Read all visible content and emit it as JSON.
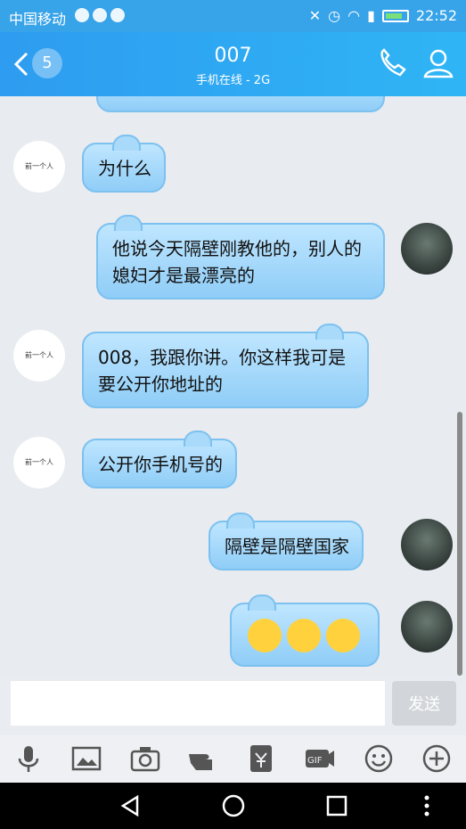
{
  "status_bar": {
    "carrier": "中国移动",
    "time": "22:52"
  },
  "header": {
    "back_badge": "5",
    "title": "007",
    "subtitle": "手机在线 - 2G"
  },
  "messages": [
    {
      "side": "left",
      "text": "为什么"
    },
    {
      "side": "right",
      "text": "他说今天隔壁刚教他的，别人的媳妇才是最漂亮的"
    },
    {
      "side": "left",
      "text": "008，我跟你讲。你这样我可是要公开你地址的"
    },
    {
      "side": "left",
      "text": "公开你手机号的"
    },
    {
      "side": "right",
      "text": "隔壁是隔壁国家"
    },
    {
      "side": "right",
      "text": ""
    }
  ],
  "avatar_left_text": "前一个人",
  "input": {
    "placeholder": "",
    "send_label": "发送"
  },
  "toolbar_icons": [
    "microphone-icon",
    "image-icon",
    "camera-icon",
    "poke-icon",
    "red-packet-icon",
    "gif-icon",
    "emoji-icon",
    "plus-icon"
  ],
  "colors": {
    "header": "#2ea6f2",
    "bubble": "#a9dafa",
    "bubble_border": "#7cc1f0"
  }
}
